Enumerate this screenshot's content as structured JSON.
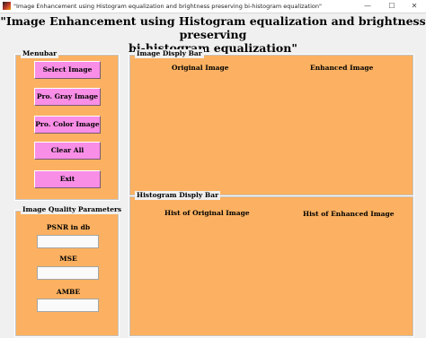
{
  "window": {
    "title": "\"Image Enhancement using Histogram equalization and brightness preserving bi-histogram equalization\"",
    "minimize": "—",
    "maximize": "☐",
    "close": "✕"
  },
  "header": {
    "title_line1": "\"Image Enhancement using Histogram equalization and brightness preserving",
    "title_line2": "bi-histogram equalization\""
  },
  "menubar": {
    "label": "Menubar",
    "buttons": [
      {
        "label": "Select Image"
      },
      {
        "label": "Pro. Gray Image"
      },
      {
        "label": "Pro. Color Image"
      },
      {
        "label": "Clear All"
      },
      {
        "label": "Exit"
      }
    ]
  },
  "quality": {
    "label": "Image Quality Parameters",
    "psnr_label": "PSNR in db",
    "psnr_value": "",
    "mse_label": "MSE",
    "mse_value": "",
    "ambe_label": "AMBE",
    "ambe_value": ""
  },
  "image_bar": {
    "label": "Image Disply Bar",
    "original": "Original Image",
    "enhanced": "Enhanced Image"
  },
  "histogram_bar": {
    "label": "Histogram Disply Bar",
    "original": "Hist of Original Image",
    "enhanced": "Hist of Enhanced Image"
  },
  "colors": {
    "panel": "#fbb161",
    "button": "#f88ee6",
    "figure_background": "#f0f0f0"
  }
}
